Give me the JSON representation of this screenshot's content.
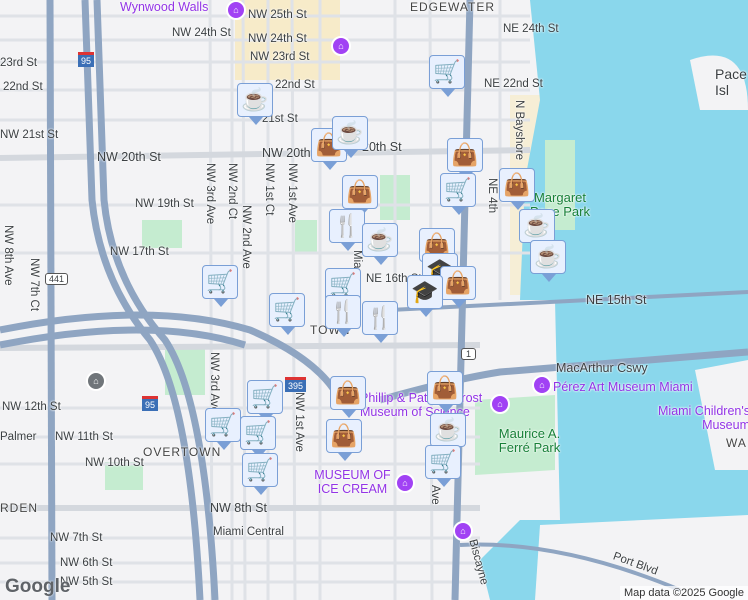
{
  "map": {
    "streets": {
      "wynwood": "Wynwood Walls",
      "nw25": "NW 25th St",
      "nw24a": "NW 24th St",
      "nw24b": "NW 24th St",
      "nw23a": "NW 23rd St",
      "nw23b": "23rd St",
      "nw22a": "22nd St",
      "nw22b": "22nd St",
      "nw21a": "NW 21st St",
      "nw21b": "21st St",
      "nw20a": "NW 20th St",
      "nw20b": "NW 20th",
      "nw20c": "20th St",
      "nw19": "NW 19th St",
      "nw17": "NW 17th St",
      "ne16": "NE 16th St",
      "ne15": "NE 15th St",
      "nw3ave": "NW 3rd Ave",
      "nw2ct": "NW 2nd Ct",
      "nw2ave": "NW 2nd Ave",
      "nw1ct": "NW 1st Ct",
      "nw1ave": "NW 1st Ave",
      "nw8ave": "NW 8th Ave",
      "nw7ct": "NW 7th Ct",
      "ne24": "NE 24th St",
      "ne22": "NE 22nd St",
      "ne4": "NE 4th",
      "bayshore": "N Bayshore",
      "macarthur": "MacArthur Cswy",
      "nw12": "NW 12th St",
      "palmer": "Palmer",
      "nw11": "NW 11th St",
      "nw10": "NW 10th St",
      "nw8": "NW 8th St",
      "nw7": "NW 7th St",
      "nw6": "NW 6th St",
      "nw5": "NW 5th St",
      "portblvd": "Port Blvd",
      "biscayne": "Biscayne",
      "nw3ave2": "NW 3rd Ave",
      "nw1ave2": "NW 1st Ave",
      "ave": "Ave",
      "mia": "Mia"
    },
    "areas": {
      "edgewater": "EDGEWATER",
      "town": "TOWN",
      "ne": "NE",
      "overtown": "OVERTOWN",
      "rden": "RDEN",
      "wa": "WA",
      "pace": "Pace",
      "isl": "Isl"
    },
    "places": {
      "margaret": "Margaret",
      "pace_park": "Pace Park",
      "perez": "Pérez Art Museum Miami",
      "childrens": "Miami Children's Museum",
      "maurice": "Maurice A. Ferré Park",
      "frost": "Phillip & Patricia Frost Museum of Science",
      "icecream": "MUSEUM OF ICE CREAM",
      "central": "Miami Central"
    },
    "shields": {
      "i95": "95",
      "i95b": "95",
      "i395": "395",
      "us441": "441",
      "us1": "1"
    },
    "markers": [
      "coffee",
      "shopping",
      "coffee",
      "shopping",
      "restaurant",
      "coffee",
      "grocery",
      "shopping",
      "grocery",
      "shopping",
      "coffee",
      "coffee",
      "shopping",
      "school",
      "shopping",
      "school",
      "grocery",
      "grocery",
      "grocery",
      "restaurant",
      "restaurant",
      "shopping",
      "grocery",
      "grocery",
      "grocery",
      "shopping",
      "shopping",
      "coffee",
      "grocery",
      "grocery"
    ],
    "attribution": "Map data ©2025 Google",
    "logo": "Google"
  },
  "colors": {
    "water": "#8ad7ec",
    "park": "#c5ecd0",
    "highway": "#8fa5c2",
    "marker_bg": "#e8f0fe",
    "marker_icon": "#0d3b63",
    "poi": "#a142f4"
  }
}
